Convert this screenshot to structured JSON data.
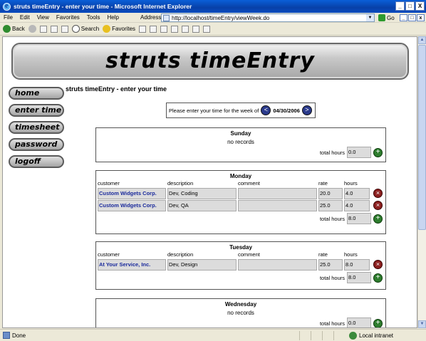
{
  "window": {
    "title": "struts timeEntry - enter your time - Microsoft Internet Explorer",
    "minimize": "_",
    "maximize": "□",
    "close": "X"
  },
  "menu": [
    "File",
    "Edit",
    "View",
    "Favorites",
    "Tools",
    "Help"
  ],
  "address": {
    "label": "Address",
    "url": "http://localhost/timeEntry/viewWeek.do",
    "go": "Go",
    "links": "»"
  },
  "toolbar": {
    "back": "Back",
    "search": "Search",
    "favorites": "Favorites"
  },
  "status": {
    "text": "Done",
    "zone": "Local intranet"
  },
  "page": {
    "banner": "struts timeEntry",
    "heading": "struts timeEntry - enter your time",
    "nav": [
      "home",
      "enter time",
      "timesheet",
      "password",
      "logoff"
    ],
    "week_prompt": "Please enter your time for the week of",
    "week_date": "04/30/2006",
    "prev": "<",
    "next": ">"
  },
  "columns": {
    "customer": "customer",
    "description": "description",
    "comment": "comment",
    "rate": "rate",
    "hours": "hours"
  },
  "total_label": "total hours",
  "no_records": "no records",
  "days": {
    "sunday": {
      "name": "Sunday",
      "total": "0.0"
    },
    "monday": {
      "name": "Monday",
      "total": "8.0",
      "rows": [
        {
          "customer": "Custom Widgets Corp.",
          "description": "Dev, Coding",
          "comment": "",
          "rate": "20.0",
          "hours": "4.0"
        },
        {
          "customer": "Custom Widgets Corp.",
          "description": "Dev, QA",
          "comment": "",
          "rate": "25.0",
          "hours": "4.0"
        }
      ]
    },
    "tuesday": {
      "name": "Tuesday",
      "total": "8.0",
      "rows": [
        {
          "customer": "At Your Service, Inc.",
          "description": "Dev, Design",
          "comment": "",
          "rate": "25.0",
          "hours": "8.0"
        }
      ]
    },
    "wednesday": {
      "name": "Wednesday",
      "total": "0.0"
    }
  },
  "colors": {
    "titlebar": "#0a4cc0",
    "customer_text": "#1a2a9c",
    "delete": "#8c2020",
    "add": "#2e7d2e"
  }
}
